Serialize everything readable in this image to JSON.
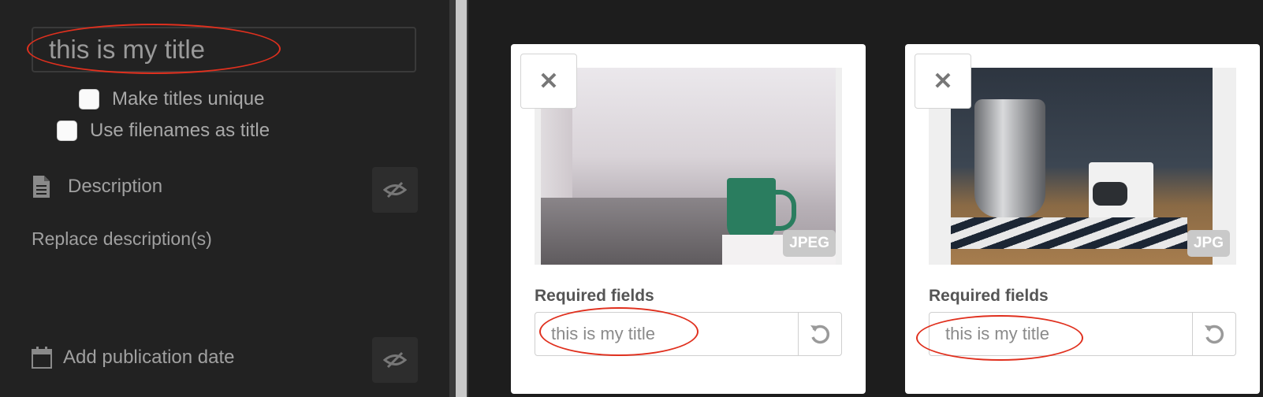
{
  "left_panel": {
    "title_value": "this is my title",
    "make_unique_label": "Make titles unique",
    "use_filenames_label": "Use filenames as title",
    "description_label": "Description",
    "replace_description": "Replace description(s)",
    "publication_date_label": "Add publication date"
  },
  "cards": [
    {
      "type_badge": "JPEG",
      "required_label": "Required fields",
      "title_value": "this is my title"
    },
    {
      "type_badge": "JPG",
      "required_label": "Required fields",
      "title_value": "this is my title"
    }
  ],
  "colors": {
    "annotation": "#e0301e",
    "panel_bg": "#222222",
    "card_bg": "#ffffff"
  }
}
